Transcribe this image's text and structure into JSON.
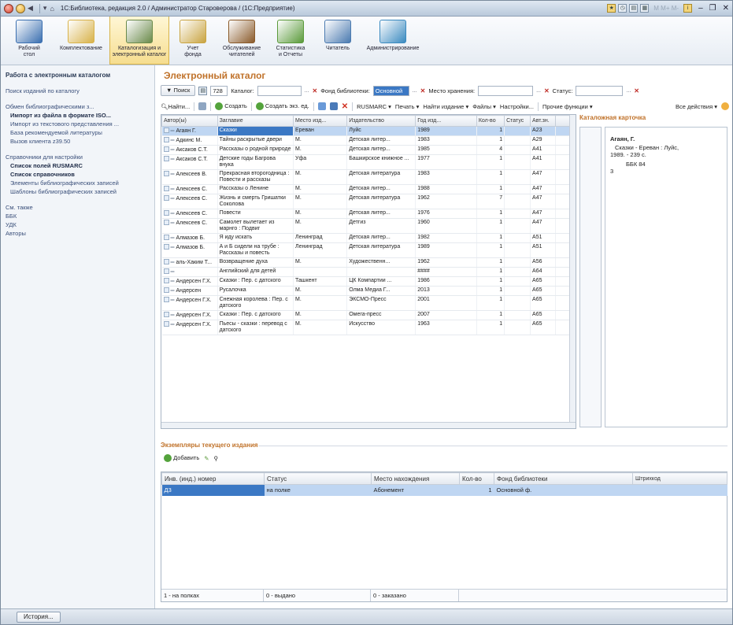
{
  "window": {
    "title": "1С:Библиотека, редакция 2.0 / Администратор Староверова / (1С:Предприятие)",
    "disabled_menu": "M M+ M-"
  },
  "ribbon": [
    {
      "label": "Рабочий\nстол",
      "color": "#3a6fb0"
    },
    {
      "label": "Комплектование",
      "color": "#d8b24a"
    },
    {
      "label": "Каталогизация и\nэлектронный каталог",
      "color": "#6a8a4a",
      "active": true
    },
    {
      "label": "Учет\nфонда",
      "color": "#c9a441"
    },
    {
      "label": "Обслуживание\nчитателей",
      "color": "#8a5a2a"
    },
    {
      "label": "Статистика\nи Отчеты",
      "color": "#5a9a3a"
    },
    {
      "label": "Читатель",
      "color": "#4a7ab0"
    },
    {
      "label": "Администрирование",
      "color": "#3a8ac0"
    }
  ],
  "sidebar": {
    "header": "Работа с электронным каталогом",
    "search_link": "Поиск изданий по каталогу",
    "exchange_header": "Обмен библиографическими з...",
    "exchange_items": [
      "Импорт из файла в формате ISO...",
      "Импорт из текстового представления ...",
      "База рекомендуемой литературы",
      "Вызов клиента z39.50"
    ],
    "refs_header": "Справочники для настройки",
    "refs_items": [
      "Список полей RUSMARC",
      "Список справочников",
      "Элементы библиографических записей",
      "Шаблоны библиографических записей"
    ],
    "see_also": "См. также",
    "see_items": [
      "ББК",
      "УДК",
      "Авторы"
    ]
  },
  "main": {
    "title": "Электронный каталог",
    "filter": {
      "search_btn": "Поиск",
      "count": "728",
      "catalog_label": "Каталог:",
      "fund_label": "Фонд библиотеки:",
      "fund_value": "Основной ф.",
      "storage_label": "Место хранения:",
      "status_label": "Статус:"
    },
    "toolbar": {
      "find": "Найти...",
      "create": "Создать",
      "create_copy": "Создать экз. ед.",
      "rusmarc": "RUSMARC",
      "print": "Печать",
      "find_edition": "Найти издание",
      "files": "Файлы",
      "settings": "Настройки...",
      "other": "Прочие функции",
      "all_actions": "Все действия"
    },
    "columns": [
      "Автор(ы)",
      "Заглавие",
      "Место изд...",
      "Издательство",
      "Год изд...",
      "Кол-во",
      "Статус",
      "Авт.зн."
    ],
    "rows": [
      {
        "author": "Агаян Г.",
        "title": "Сказки",
        "place": "Ереван",
        "pub": "Луйс",
        "year": "1989",
        "qty": "1",
        "status": "",
        "mark": "А23",
        "sel": true
      },
      {
        "author": "Адкинс М.",
        "title": "Тайны раскрытые двери",
        "place": "М.",
        "pub": "Детская литер...",
        "year": "1983",
        "qty": "1",
        "status": "",
        "mark": "А29"
      },
      {
        "author": "Аксаков С.Т.",
        "title": "Рассказы о родной природе",
        "place": "М.",
        "pub": "Детская литер...",
        "year": "1985",
        "qty": "4",
        "status": "",
        "mark": "А41"
      },
      {
        "author": "Аксаков С.Т.",
        "title": "Детские годы Багрова внука",
        "place": "Уфа",
        "pub": "Башкирское книжное ...",
        "year": "1977",
        "qty": "1",
        "status": "",
        "mark": "А41"
      },
      {
        "author": "Алексеев В.",
        "title": "Прекрасная второгодница : Повести и рассказы",
        "place": "М.",
        "pub": "Детская литература",
        "year": "1983",
        "qty": "1",
        "status": "",
        "mark": "А47"
      },
      {
        "author": "Алексеев С.",
        "title": "Рассказы о Ленине",
        "place": "М.",
        "pub": "Детская литер...",
        "year": "1988",
        "qty": "1",
        "status": "",
        "mark": "А47"
      },
      {
        "author": "Алексеев С.",
        "title": "Жизнь и смерть Гришатки Соколова",
        "place": "М.",
        "pub": "Детская литература",
        "year": "1962",
        "qty": "7",
        "status": "",
        "mark": "А47"
      },
      {
        "author": "Алексеев С.",
        "title": "Повести",
        "place": "М.",
        "pub": "Детская литер...",
        "year": "1976",
        "qty": "1",
        "status": "",
        "mark": "А47"
      },
      {
        "author": "Алексеев С.",
        "title": "Самолет вылетает из марнго : Подвиг",
        "place": "М.",
        "pub": "Детгиз",
        "year": "1960",
        "qty": "1",
        "status": "",
        "mark": "А47"
      },
      {
        "author": "Алмазов Б.",
        "title": "Я иду искать",
        "place": "Ленинград",
        "pub": "Детская литер...",
        "year": "1982",
        "qty": "1",
        "status": "",
        "mark": "А51"
      },
      {
        "author": "Алмазов Б.",
        "title": "А и Б сидели на трубе : Рассказы и повесть",
        "place": "Ленинград",
        "pub": "Детская литература",
        "year": "1989",
        "qty": "1",
        "status": "",
        "mark": "А51"
      },
      {
        "author": "аль-Хаким Т...",
        "title": "Возвращение духа",
        "place": "М.",
        "pub": "Художественн...",
        "year": "1962",
        "qty": "1",
        "status": "",
        "mark": "А56"
      },
      {
        "author": "",
        "title": "Английский для детей",
        "place": "",
        "pub": "",
        "year": "####",
        "qty": "1",
        "status": "",
        "mark": "А64"
      },
      {
        "author": "Андерсен Г.Х.",
        "title": "Сказки : Пер. с датского",
        "place": "Ташкент",
        "pub": "ЦК Компартии ...",
        "year": "1986",
        "qty": "1",
        "status": "",
        "mark": "А65"
      },
      {
        "author": "Андерсен",
        "title": "Русалочка",
        "place": "М.",
        "pub": "Олма Медиа Г...",
        "year": "2013",
        "qty": "1",
        "status": "",
        "mark": "А65"
      },
      {
        "author": "Андерсен Г.Х.",
        "title": "Снежная королева : Пер. с датского",
        "place": "М.",
        "pub": "ЭКСМО-Пресс",
        "year": "2001",
        "qty": "1",
        "status": "",
        "mark": "А65"
      },
      {
        "author": "Андерсен Г.Х.",
        "title": "Сказки : Пер. с датского",
        "place": "М.",
        "pub": "Омега-пресс",
        "year": "2007",
        "qty": "1",
        "status": "",
        "mark": "А65"
      },
      {
        "author": "Андерсен Г.Х.",
        "title": "Пьесы - сказки : перевод с датского",
        "place": "М.",
        "pub": "Искусство",
        "year": "1963",
        "qty": "1",
        "status": "",
        "mark": "А65"
      }
    ],
    "card": {
      "title": "Каталожная карточка",
      "line1": "Агаян, Г.",
      "line2": "Сказки - Ереван : Луйс,",
      "line3": "1989. - 239 с.",
      "line4": "ББК 84",
      "line5": "3"
    },
    "copies": {
      "title": "Экземпляры текущего издания",
      "add": "Добавить",
      "columns": [
        "Инв. (инд.) номер",
        "Статус",
        "Место нахождения",
        "Кол-во",
        "Фонд библиотеки",
        "Штрихкод"
      ],
      "rows": [
        {
          "inv": "Д3",
          "status": "на полке",
          "place": "Абонемент",
          "qty": "1",
          "fund": "Основной ф.",
          "barcode": ""
        }
      ],
      "footer": [
        "1 - на полках",
        "0 - выдано",
        "0 - заказано"
      ]
    }
  },
  "status": {
    "history": "История..."
  }
}
